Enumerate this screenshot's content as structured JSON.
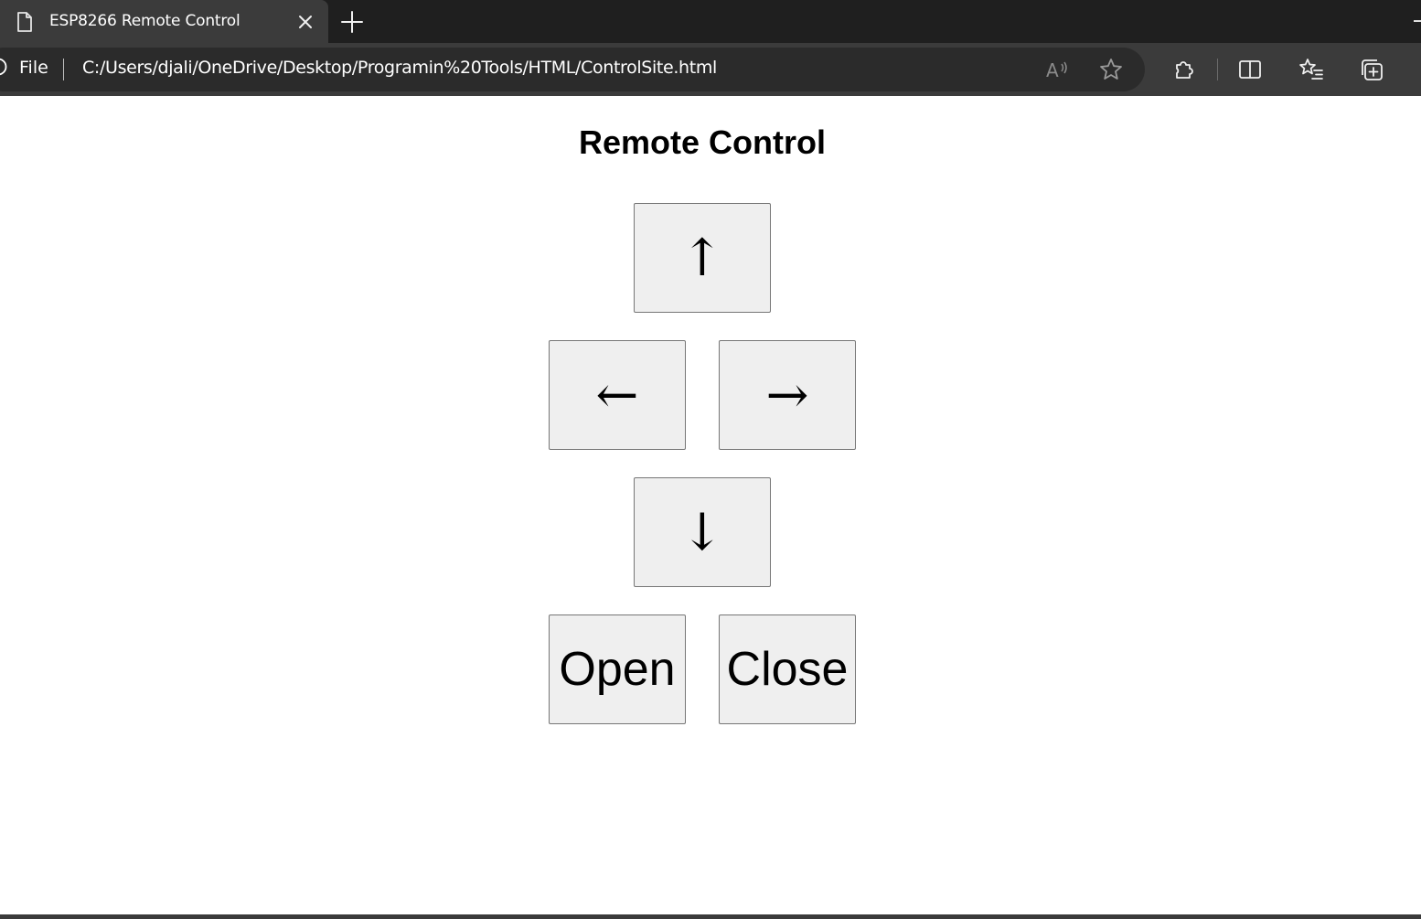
{
  "browser": {
    "tab_title": "ESP8266 Remote Control",
    "scheme_label": "File",
    "url": "C:/Users/djali/OneDrive/Desktop/Programin%20Tools/HTML/ControlSite.html"
  },
  "page": {
    "title": "Remote Control",
    "buttons": {
      "up": "↑",
      "left": "←",
      "right": "→",
      "down": "↓",
      "open": "Open",
      "close": "Close"
    }
  },
  "colors": {
    "tabstrip": "#1f1f1f",
    "toolbar": "#3b3b3b",
    "button_face": "#efefef",
    "button_border": "#767676"
  }
}
